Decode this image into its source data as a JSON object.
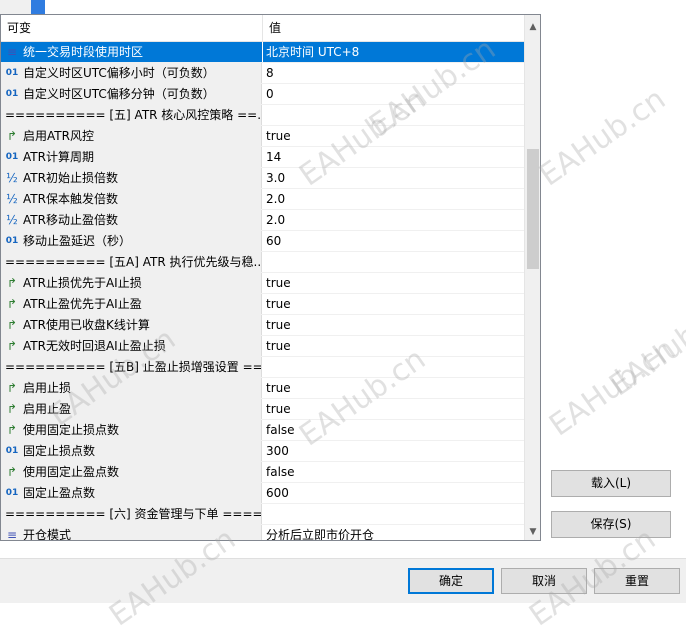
{
  "header": {
    "col_name": "可变",
    "col_value": "值"
  },
  "rows": [
    {
      "icon": "enum",
      "name": "统一交易时段使用时区",
      "value": "北京时间 UTC+8",
      "selected": true
    },
    {
      "icon": "num",
      "name": "自定义时区UTC偏移小时（可负数）",
      "value": "8"
    },
    {
      "icon": "num",
      "name": "自定义时区UTC偏移分钟（可负数）",
      "value": "0"
    },
    {
      "icon": "none",
      "name": "========== [五] ATR 核心风控策略 ==...",
      "value": "",
      "sep": true
    },
    {
      "icon": "bool",
      "name": "启用ATR风控",
      "value": "true"
    },
    {
      "icon": "num",
      "name": "ATR计算周期",
      "value": "14"
    },
    {
      "icon": "half",
      "name": "ATR初始止损倍数",
      "value": "3.0"
    },
    {
      "icon": "half",
      "name": "ATR保本触发倍数",
      "value": "2.0"
    },
    {
      "icon": "half",
      "name": "ATR移动止盈倍数",
      "value": "2.0"
    },
    {
      "icon": "num",
      "name": "移动止盈延迟（秒）",
      "value": "60"
    },
    {
      "icon": "none",
      "name": "========== [五A] ATR 执行优先级与稳...",
      "value": "",
      "sep": true
    },
    {
      "icon": "bool",
      "name": "ATR止损优先于AI止损",
      "value": "true"
    },
    {
      "icon": "bool",
      "name": "ATR止盈优先于AI止盈",
      "value": "true"
    },
    {
      "icon": "bool",
      "name": "ATR使用已收盘K线计算",
      "value": "true"
    },
    {
      "icon": "bool",
      "name": "ATR无效时回退AI止盈止损",
      "value": "true"
    },
    {
      "icon": "none",
      "name": "========== [五B] 止盈止损增强设置 ==...",
      "value": "",
      "sep": true
    },
    {
      "icon": "bool",
      "name": "启用止损",
      "value": "true"
    },
    {
      "icon": "bool",
      "name": "启用止盈",
      "value": "true"
    },
    {
      "icon": "bool",
      "name": "使用固定止损点数",
      "value": "false"
    },
    {
      "icon": "num",
      "name": "固定止损点数",
      "value": "300"
    },
    {
      "icon": "bool",
      "name": "使用固定止盈点数",
      "value": "false"
    },
    {
      "icon": "num",
      "name": "固定止盈点数",
      "value": "600"
    },
    {
      "icon": "none",
      "name": "========== [六] 资金管理与下单 ====...",
      "value": "",
      "sep": true
    },
    {
      "icon": "enum",
      "name": "开仓模式",
      "value": "分析后立即市价开仓"
    }
  ],
  "side_buttons": {
    "load": "载入(L)",
    "save": "保存(S)"
  },
  "footer_buttons": {
    "ok": "确定",
    "cancel": "取消",
    "reset": "重置"
  },
  "scrollbar": {
    "up": "▲",
    "down": "▼"
  },
  "icons": {
    "num": "01",
    "half": "½",
    "bool": "↱",
    "enum": "≡",
    "none": ""
  },
  "watermark": "EAHub.cn",
  "colors": {
    "selection": "#0078d7",
    "accent": "#2f7ce0"
  }
}
